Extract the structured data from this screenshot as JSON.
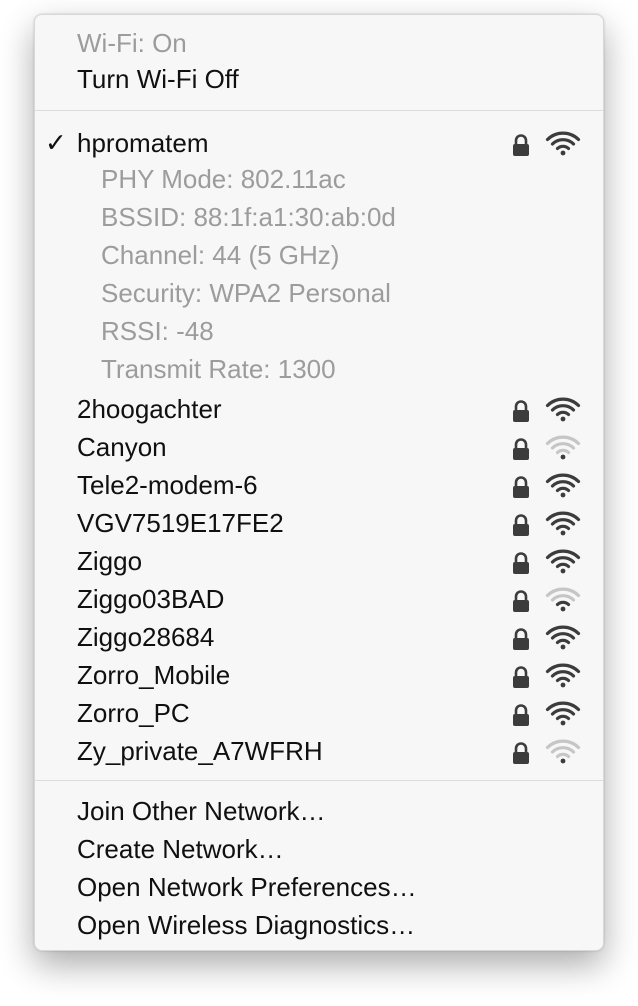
{
  "status": {
    "wifi_status": "Wi-Fi: On",
    "toggle_label": "Turn Wi-Fi Off"
  },
  "connected": {
    "name": "hpromatem",
    "checkmark": "✓",
    "details": [
      "PHY Mode: 802.11ac",
      "BSSID: 88:1f:a1:30:ab:0d",
      "Channel: 44 (5 GHz)",
      "Security: WPA2 Personal",
      "RSSI: -48",
      "Transmit Rate: 1300"
    ],
    "locked": true,
    "signal_bars": 4
  },
  "networks": [
    {
      "name": "2hoogachter",
      "locked": true,
      "signal_bars": 4
    },
    {
      "name": "Canyon",
      "locked": true,
      "signal_bars": 1
    },
    {
      "name": "Tele2-modem-6",
      "locked": true,
      "signal_bars": 4
    },
    {
      "name": "VGV7519E17FE2",
      "locked": true,
      "signal_bars": 4
    },
    {
      "name": "Ziggo",
      "locked": true,
      "signal_bars": 4
    },
    {
      "name": "Ziggo03BAD",
      "locked": true,
      "signal_bars": 2
    },
    {
      "name": "Ziggo28684",
      "locked": true,
      "signal_bars": 4
    },
    {
      "name": "Zorro_Mobile",
      "locked": true,
      "signal_bars": 4
    },
    {
      "name": "Zorro_PC",
      "locked": true,
      "signal_bars": 4
    },
    {
      "name": "Zy_private_A7WFRH",
      "locked": true,
      "signal_bars": 1
    }
  ],
  "actions": {
    "join_other": "Join Other Network…",
    "create_network": "Create Network…",
    "open_prefs": "Open Network Preferences…",
    "open_diagnostics": "Open Wireless Diagnostics…"
  },
  "colors": {
    "menu_bg": "#f7f7f7",
    "text": "#101010",
    "dim_text": "#9c9c9c",
    "icon_active": "#3c3c3c",
    "icon_inactive": "#c6c6c6"
  }
}
